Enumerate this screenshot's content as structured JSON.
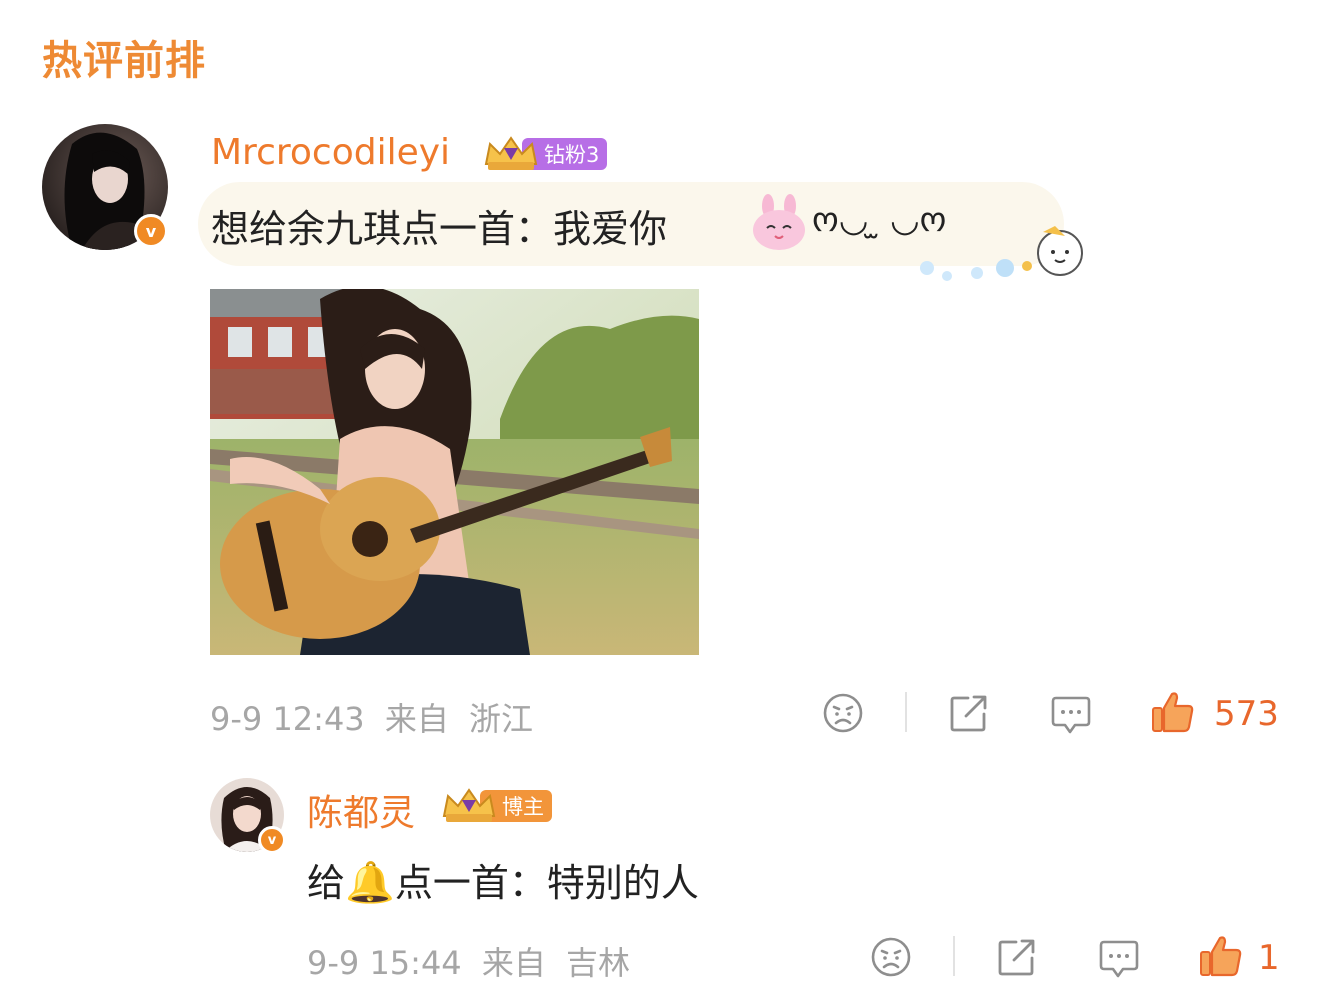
{
  "section": {
    "title": "热评前排"
  },
  "comments": [
    {
      "username": "Mrcrocodileyi",
      "badge": "钻粉3",
      "badge_color": "#b76ee6",
      "text": "想给余九琪点一首：我爱你",
      "kaomoji": "ო◡ ̫ ◡ო",
      "time": "9-9 12:43",
      "from_label": "来自",
      "location": "浙江",
      "likes": "573"
    },
    {
      "username": "陈都灵",
      "badge": "博主",
      "badge_color": "#f2953a",
      "text_prefix": "给",
      "bell_emoji": "🔔",
      "text_suffix": "点一首：特别的人",
      "time": "9-9 15:44",
      "from_label": "来自",
      "location": "吉林",
      "likes": "1"
    }
  ],
  "icons": [
    "dislike-face-icon",
    "share-icon",
    "comment-icon",
    "like-thumb-icon",
    "verified-v-icon",
    "crown-icon",
    "bunny-emoji-icon"
  ],
  "colors": {
    "accent": "#ee7a2c",
    "like": "#e8672c",
    "meta": "#a6a6a6"
  }
}
